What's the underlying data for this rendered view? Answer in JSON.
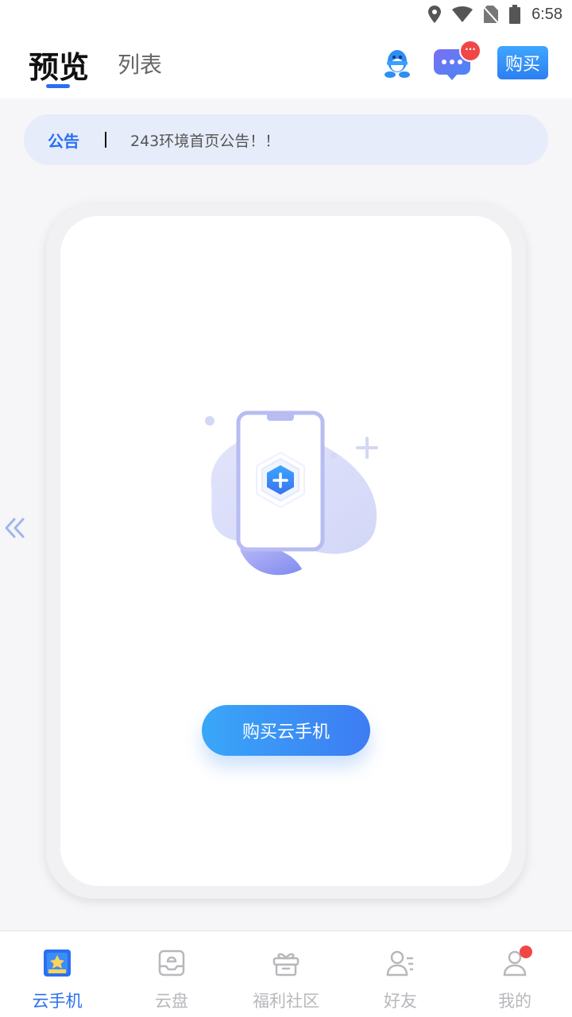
{
  "status_bar": {
    "time": "6:58"
  },
  "header": {
    "tabs": [
      {
        "label": "预览",
        "active": true
      },
      {
        "label": "列表",
        "active": false
      }
    ],
    "buy_label": "购买",
    "message_badge": "···"
  },
  "notice": {
    "label": "公告",
    "text": "243环境首页公告！！"
  },
  "card": {
    "button_label": "购买云手机"
  },
  "bottom_nav": {
    "items": [
      {
        "label": "云手机",
        "icon": "cloud-phone-icon",
        "active": true
      },
      {
        "label": "云盘",
        "icon": "cloud-disk-icon",
        "active": false
      },
      {
        "label": "福利社区",
        "icon": "gift-icon",
        "active": false
      },
      {
        "label": "好友",
        "icon": "friends-icon",
        "active": false
      },
      {
        "label": "我的",
        "icon": "profile-icon",
        "active": false
      }
    ]
  },
  "colors": {
    "accent": "#2a6ff2",
    "badge": "#f04646",
    "notice_bg": "#e6ecf9"
  }
}
